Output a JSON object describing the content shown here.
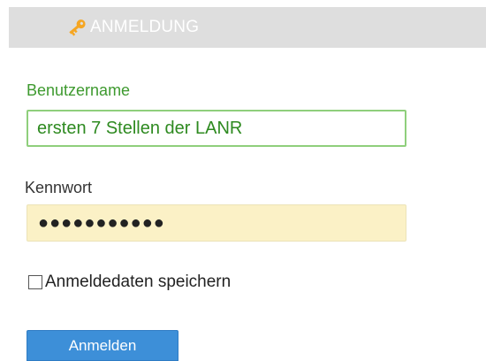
{
  "header": {
    "title": "ANMELDUNG",
    "icon": "key-icon",
    "background_color": "#dedede",
    "icon_color": "#f5a623"
  },
  "form": {
    "username": {
      "label": "Benutzername",
      "value": "ersten 7 Stellen der LANR",
      "label_color": "#3e9a2f",
      "border_color": "#8fcf7c"
    },
    "password": {
      "label": "Kennwort",
      "value": "●●●●●●●●●●●",
      "background_color": "#fbf1c6"
    },
    "remember": {
      "label": "Anmeldedaten speichern",
      "checked": false
    },
    "submit": {
      "label": "Anmelden",
      "color": "#3d8fd8"
    }
  }
}
